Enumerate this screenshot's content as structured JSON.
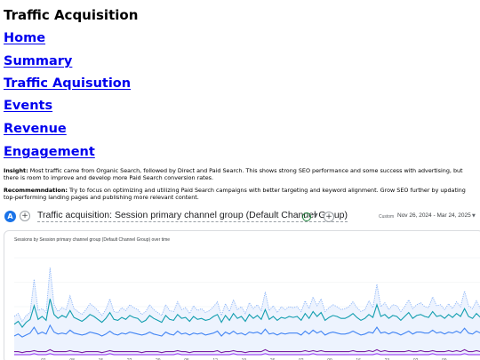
{
  "page": {
    "title": "Traffic Acquisition"
  },
  "nav": [
    {
      "label": "Home"
    },
    {
      "label": "Summary"
    },
    {
      "label": "Traffic Aquisution"
    },
    {
      "label": "Events"
    },
    {
      "label": "Revenue"
    },
    {
      "label": "Engagement"
    }
  ],
  "insight": {
    "label": "Insight:",
    "text": " Most traffic came from Organic Search, followed by Direct and Paid Search. This shows strong SEO performance and some success with advertising, but there is room to improve and develop more Paid Search conversion rates."
  },
  "recommendation": {
    "label": "Recommemndation:",
    "text": " Try to focus on optimizing and utilizing Paid Search campaigns with better targeting and keyword alignment. Grow SEO further by updating top-performing landing pages and publishing more relevant content."
  },
  "ga": {
    "avatar_letter": "A",
    "report_title": "Traffic acquisition: Session primary channel group (Default Channel Group)",
    "custom_label": "Custom",
    "date_range": "Nov 26, 2024 - Mar 24, 2025",
    "icons": [
      "plus-icon",
      "check-circle-icon",
      "chevron-down-icon",
      "plus-icon",
      "chevron-down-icon"
    ],
    "colors": {
      "accent": "#1a73e8",
      "check": "#188038"
    }
  },
  "chart_data": {
    "type": "line",
    "title": "Sessions by Session primary channel group (Default Channel Group) over time",
    "xlabel": "",
    "ylabel": "",
    "x_tick_labels": [
      "01",
      "08",
      "15",
      "22",
      "29",
      "05",
      "12",
      "19",
      "26",
      "02",
      "09",
      "16",
      "23",
      "02",
      "09"
    ],
    "grid": true,
    "series": [
      {
        "color": "#8ab4f8",
        "style": "dotted-area",
        "values": [
          40,
          43,
          35,
          41,
          44,
          78,
          46,
          48,
          44,
          90,
          52,
          45,
          49,
          47,
          61,
          48,
          45,
          42,
          47,
          53,
          50,
          46,
          41,
          47,
          58,
          45,
          44,
          49,
          46,
          52,
          49,
          47,
          42,
          45,
          52,
          47,
          44,
          41,
          52,
          46,
          45,
          55,
          47,
          49,
          43,
          51,
          46,
          48,
          44,
          46,
          50,
          55,
          41,
          53,
          45,
          57,
          47,
          50,
          43,
          54,
          48,
          52,
          46,
          65,
          46,
          51,
          44,
          50,
          47,
          50,
          49,
          50,
          45,
          56,
          48,
          60,
          51,
          58,
          45,
          49,
          52,
          50,
          47,
          48,
          50,
          55,
          49,
          45,
          47,
          56,
          49,
          73,
          50,
          54,
          47,
          52,
          51,
          45,
          50,
          57,
          48,
          52,
          54,
          50,
          49,
          60,
          51,
          52,
          47,
          53,
          48,
          55,
          50,
          66,
          51,
          48,
          56,
          48,
          57
        ]
      },
      {
        "color": "#129eaf",
        "style": "solid",
        "values": [
          32,
          35,
          29,
          34,
          37,
          51,
          37,
          40,
          36,
          58,
          42,
          38,
          41,
          39,
          46,
          39,
          37,
          35,
          38,
          42,
          40,
          37,
          34,
          38,
          44,
          37,
          36,
          39,
          37,
          41,
          39,
          38,
          34,
          36,
          41,
          38,
          36,
          34,
          41,
          37,
          36,
          42,
          38,
          39,
          35,
          40,
          37,
          38,
          36,
          37,
          40,
          42,
          34,
          41,
          36,
          43,
          38,
          40,
          35,
          42,
          38,
          41,
          37,
          47,
          37,
          40,
          36,
          39,
          38,
          40,
          39,
          40,
          36,
          43,
          38,
          45,
          40,
          44,
          36,
          39,
          41,
          40,
          38,
          38,
          40,
          43,
          39,
          36,
          38,
          42,
          39,
          52,
          40,
          42,
          38,
          41,
          40,
          36,
          40,
          44,
          38,
          41,
          42,
          40,
          39,
          45,
          40,
          41,
          38,
          42,
          39,
          43,
          40,
          48,
          40,
          38,
          43,
          39,
          44
        ]
      },
      {
        "color": "#4285f4",
        "style": "solid",
        "values": [
          20,
          22,
          19,
          21,
          23,
          29,
          22,
          24,
          22,
          31,
          24,
          22,
          23,
          22,
          26,
          23,
          22,
          21,
          22,
          24,
          23,
          22,
          20,
          22,
          25,
          22,
          21,
          23,
          22,
          24,
          23,
          22,
          21,
          22,
          24,
          22,
          21,
          20,
          24,
          22,
          21,
          25,
          22,
          23,
          21,
          23,
          22,
          23,
          21,
          22,
          23,
          25,
          20,
          24,
          22,
          25,
          22,
          23,
          21,
          24,
          23,
          24,
          22,
          27,
          22,
          23,
          21,
          23,
          22,
          23,
          23,
          23,
          21,
          25,
          22,
          26,
          23,
          25,
          21,
          23,
          24,
          23,
          22,
          22,
          23,
          25,
          23,
          21,
          22,
          24,
          23,
          29,
          23,
          24,
          22,
          24,
          23,
          21,
          23,
          25,
          22,
          24,
          24,
          23,
          23,
          26,
          23,
          24,
          22,
          24,
          23,
          25,
          23,
          28,
          23,
          22,
          25,
          23,
          25
        ]
      },
      {
        "color": "#7b1fa2",
        "style": "solid",
        "values": [
          4,
          4,
          3,
          4,
          4,
          5,
          4,
          4,
          4,
          6,
          4,
          4,
          4,
          4,
          5,
          4,
          4,
          3,
          4,
          4,
          4,
          4,
          3,
          4,
          5,
          4,
          4,
          4,
          4,
          4,
          4,
          4,
          3,
          4,
          4,
          4,
          4,
          3,
          4,
          4,
          4,
          5,
          4,
          4,
          3,
          4,
          4,
          4,
          4,
          4,
          4,
          5,
          3,
          4,
          4,
          5,
          4,
          4,
          3,
          4,
          4,
          4,
          4,
          6,
          4,
          4,
          4,
          4,
          4,
          4,
          4,
          4,
          4,
          5,
          4,
          5,
          4,
          5,
          4,
          4,
          4,
          4,
          4,
          4,
          4,
          5,
          4,
          4,
          4,
          5,
          4,
          6,
          4,
          5,
          4,
          4,
          4,
          4,
          4,
          5,
          4,
          4,
          5,
          4,
          4,
          5,
          4,
          4,
          4,
          5,
          4,
          5,
          4,
          6,
          4,
          4,
          5,
          4,
          5
        ]
      },
      {
        "color": "#a142f4",
        "style": "solid",
        "values": [
          1,
          1,
          1,
          1,
          1,
          2,
          1,
          1,
          1,
          2,
          1,
          1,
          1,
          1,
          1,
          1,
          1,
          1,
          1,
          1,
          1,
          1,
          1,
          1,
          2,
          1,
          1,
          1,
          1,
          1,
          1,
          1,
          1,
          1,
          1,
          1,
          1,
          1,
          1,
          1,
          1,
          2,
          1,
          1,
          1,
          1,
          1,
          1,
          1,
          1,
          1,
          1,
          1,
          1,
          1,
          2,
          1,
          1,
          1,
          1,
          1,
          1,
          1,
          2,
          1,
          1,
          1,
          1,
          1,
          1,
          1,
          1,
          1,
          1,
          1,
          2,
          1,
          1,
          1,
          1,
          1,
          1,
          1,
          1,
          1,
          1,
          1,
          1,
          1,
          1,
          1,
          2,
          1,
          1,
          1,
          1,
          1,
          1,
          1,
          1,
          1,
          1,
          1,
          1,
          1,
          2,
          1,
          1,
          1,
          1,
          1,
          1,
          1,
          2,
          1,
          1,
          1,
          1,
          1
        ]
      }
    ]
  }
}
